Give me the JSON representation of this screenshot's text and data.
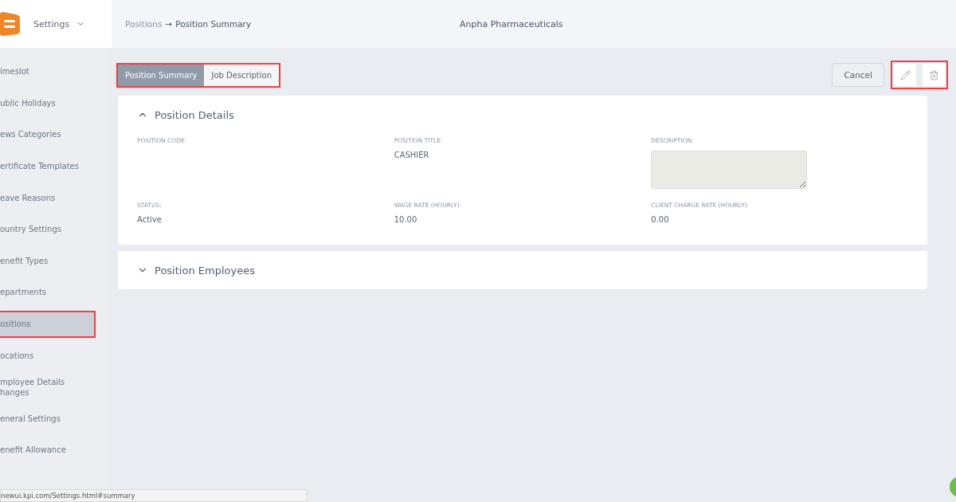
{
  "header": {
    "menu_label": "Settings",
    "separator": "→",
    "breadcrumb": [
      {
        "label": "Positions",
        "current": false
      },
      {
        "label": "Position Summary",
        "current": true
      }
    ],
    "company": "Anpha Pharmaceuticals"
  },
  "sidebar": {
    "items": [
      {
        "label": "imeslot",
        "selected": false,
        "highlighted": false
      },
      {
        "label": "ublic Holidays",
        "selected": false,
        "highlighted": false
      },
      {
        "label": "ews Categories",
        "selected": false,
        "highlighted": false
      },
      {
        "label": "ertificate Templates",
        "selected": false,
        "highlighted": false
      },
      {
        "label": "eave Reasons",
        "selected": false,
        "highlighted": false
      },
      {
        "label": "ountry Settings",
        "selected": false,
        "highlighted": false
      },
      {
        "label": "enefit Types",
        "selected": false,
        "highlighted": false
      },
      {
        "label": "epartments",
        "selected": false,
        "highlighted": false
      },
      {
        "label": "ositions",
        "selected": true,
        "highlighted": true
      },
      {
        "label": "ocations",
        "selected": false,
        "highlighted": false
      },
      {
        "label": "mployee Details hanges",
        "selected": false,
        "highlighted": false
      },
      {
        "label": "eneral Settings",
        "selected": false,
        "highlighted": false
      },
      {
        "label": "enefit Allowance",
        "selected": false,
        "highlighted": false
      }
    ]
  },
  "tabs": {
    "highlighted": true,
    "items": [
      {
        "label": "Position Summary",
        "selected": true
      },
      {
        "label": "Job Description",
        "selected": false
      }
    ]
  },
  "actions": {
    "cancel": "Cancel",
    "icons_highlighted": true
  },
  "sections": [
    {
      "title": "Position Details",
      "expanded": true,
      "fields": [
        {
          "label": "POSITION CODE:",
          "kind": "text"
        },
        {
          "label": "POSITION TITLE:",
          "kind": "text",
          "value": "CASHIER"
        },
        {
          "label": "DESCRIPTION:",
          "kind": "textarea"
        },
        {
          "label": "STATUS:",
          "kind": "text",
          "value": "Active"
        },
        {
          "label": "WAGE RATE (HOURLY):",
          "kind": "text",
          "value": "10.00"
        },
        {
          "label": "CLIENT CHARGE RATE (HOURLY):",
          "kind": "text",
          "value": "0.00"
        }
      ]
    },
    {
      "title": "Position Employees",
      "expanded": false
    }
  ],
  "status_url": "newui.kpi.com/Settings.html#summary"
}
